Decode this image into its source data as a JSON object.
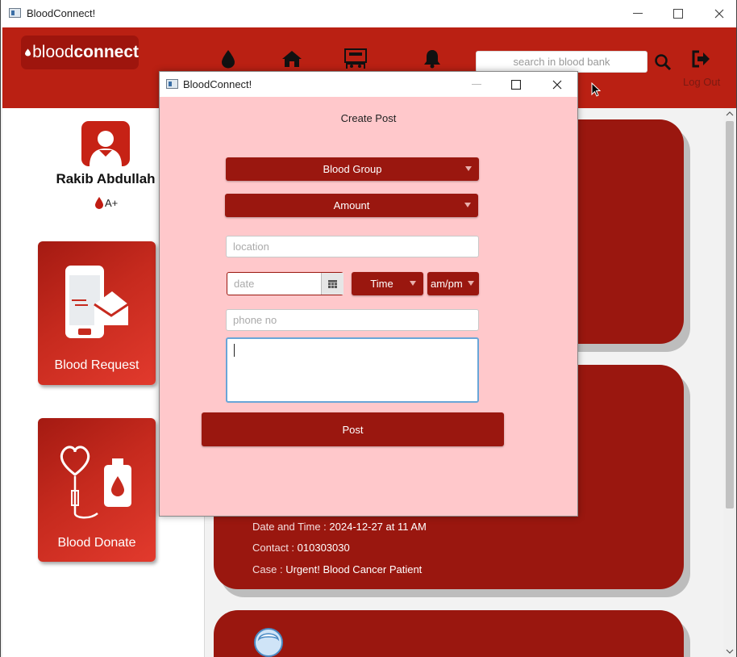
{
  "app": {
    "title": "BloodConnect!"
  },
  "logo": {
    "part1": "blood",
    "part2": "connect"
  },
  "search": {
    "placeholder": "search in blood bank"
  },
  "header": {
    "logout_label": "Log Out"
  },
  "profile": {
    "name": "Rakib Abdullah",
    "blood_group": "A+"
  },
  "cards": {
    "request_label": "Blood Request",
    "donate_label": "Blood Donate"
  },
  "feed": {
    "post2": {
      "date_time_label": "Date and Time :",
      "date_time_value": "2024-12-27 at 11 AM",
      "contact_label": "Contact :",
      "contact_value": "010303030",
      "case_label": "Case :",
      "case_value": "Urgent! Blood Cancer Patient"
    }
  },
  "dialog": {
    "title": "BloodConnect!",
    "heading": "Create Post",
    "blood_group_label": "Blood Group",
    "amount_label": "Amount",
    "location_placeholder": "location",
    "date_placeholder": "date",
    "time_label": "Time",
    "ampm_label": "am/pm",
    "phone_placeholder": "phone no",
    "post_label": "Post"
  },
  "colors": {
    "brand": "#ba2013",
    "accent_dark": "#9a170f",
    "dialog_bg": "#ffc8cb"
  },
  "icons": [
    "blood-drop-icon",
    "home-icon",
    "hospital-icon",
    "bell-icon",
    "search-icon",
    "logout-icon",
    "calendar-icon",
    "user-avatar-icon"
  ]
}
